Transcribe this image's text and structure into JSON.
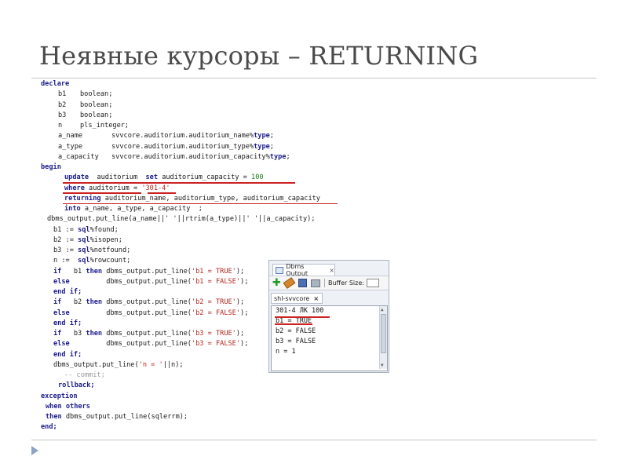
{
  "slide": {
    "title": "Неявные курсоры – RETURNING"
  },
  "code": {
    "l01": "declare",
    "l02_name": "b1",
    "l02_type": "boolean;",
    "l03_name": "b2",
    "l03_type": "boolean;",
    "l04_name": "b3",
    "l04_type": "boolean;",
    "l05_name": "n",
    "l05_type": "pls_integer;",
    "l06_name": "a_name",
    "l06_a": "svvcore.auditorium.auditorium_name%",
    "l06_k": "type",
    "l06_e": ";",
    "l07_name": "a_type",
    "l07_a": "svvcore.auditorium.auditorium_type%",
    "l07_k": "type",
    "l07_e": ";",
    "l08_name": "a_capacity",
    "l08_a": "svvcore.auditorium.auditorium_capacity%",
    "l08_k": "type",
    "l08_e": ";",
    "l09": "begin",
    "l10_k1": "update",
    "l10_a": "  auditorium  ",
    "l10_k2": "set",
    "l10_b": " auditorium_capacity = ",
    "l10_n": "100",
    "l11_k": "where",
    "l11_a": " auditorium = ",
    "l11_s": "'301-4'",
    "l12_k": "returning",
    "l12_a": " auditorium_name, auditorium_type, auditorium_capacity",
    "l13_k": "into",
    "l13_a": " a_name, a_type, a_capacity  ;",
    "l14": "dbms_output.put_line(a_name||' '||rtrim(a_type)||' '||a_capacity);",
    "l15_a": "b1 := ",
    "l15_k": "sql",
    "l15_b": "%found;",
    "l16_a": "b2 := ",
    "l16_k": "sql",
    "l16_b": "%isopen;",
    "l17_a": "b3 := ",
    "l17_k": "sql",
    "l17_b": "%notfound;",
    "l18_a": "n :=  ",
    "l18_k": "sql",
    "l18_b": "%rowcount;",
    "l19_k1": "if",
    "l19_a": "   b1 ",
    "l19_k2": "then",
    "l19_b": " dbms_output.put_line(",
    "l19_s": "'b1 = TRUE'",
    "l19_e": ");",
    "l20_k": "else",
    "l20_b": "         dbms_output.put_line(",
    "l20_s": "'b1 = FALSE'",
    "l20_e": ");",
    "l21": "end if;",
    "l22_k1": "if",
    "l22_a": "   b2 ",
    "l22_k2": "then",
    "l22_b": " dbms_output.put_line(",
    "l22_s": "'b2 = TRUE'",
    "l22_e": ");",
    "l23_k": "else",
    "l23_b": "         dbms_output.put_line(",
    "l23_s": "'b2 = FALSE'",
    "l23_e": ");",
    "l24": "end if;",
    "l25_k1": "if",
    "l25_a": "   b3 ",
    "l25_k2": "then",
    "l25_b": " dbms_output.put_line(",
    "l25_s": "'b3 = TRUE'",
    "l25_e": ");",
    "l26_k": "else",
    "l26_b": "         dbms_output.put_line(",
    "l26_s": "'b3 = FALSE'",
    "l26_e": ");",
    "l27": "end if;",
    "l28_a": "dbms_output.put_line(",
    "l28_s": "'n = '",
    "l28_b": "||n);",
    "l29": "-- commit;",
    "l30": "rollback;",
    "l31": "exception",
    "l32": "when others",
    "l33_k": "then",
    "l33_a": " dbms_output.put_line(sqlerrm);",
    "l34": "end;"
  },
  "dbms_panel": {
    "tab_title": "Dbms Output",
    "tab_close": "×",
    "buffer_label": "Buffer Size:",
    "connection_tab": "shl-svvcore",
    "connection_close": "×",
    "output_lines": [
      "301-4 ЛК 100",
      "b1 = TRUE",
      "b2 = FALSE",
      "b3 = FALSE",
      "n = 1"
    ]
  },
  "colors": {
    "keyword": "#1c1c8c",
    "string": "#b3281e",
    "number": "#1a7a1a",
    "underline": "#cc2222"
  },
  "icons": [
    "add-icon",
    "eraser-icon",
    "save-icon",
    "print-icon",
    "bullet-arrow-icon"
  ]
}
